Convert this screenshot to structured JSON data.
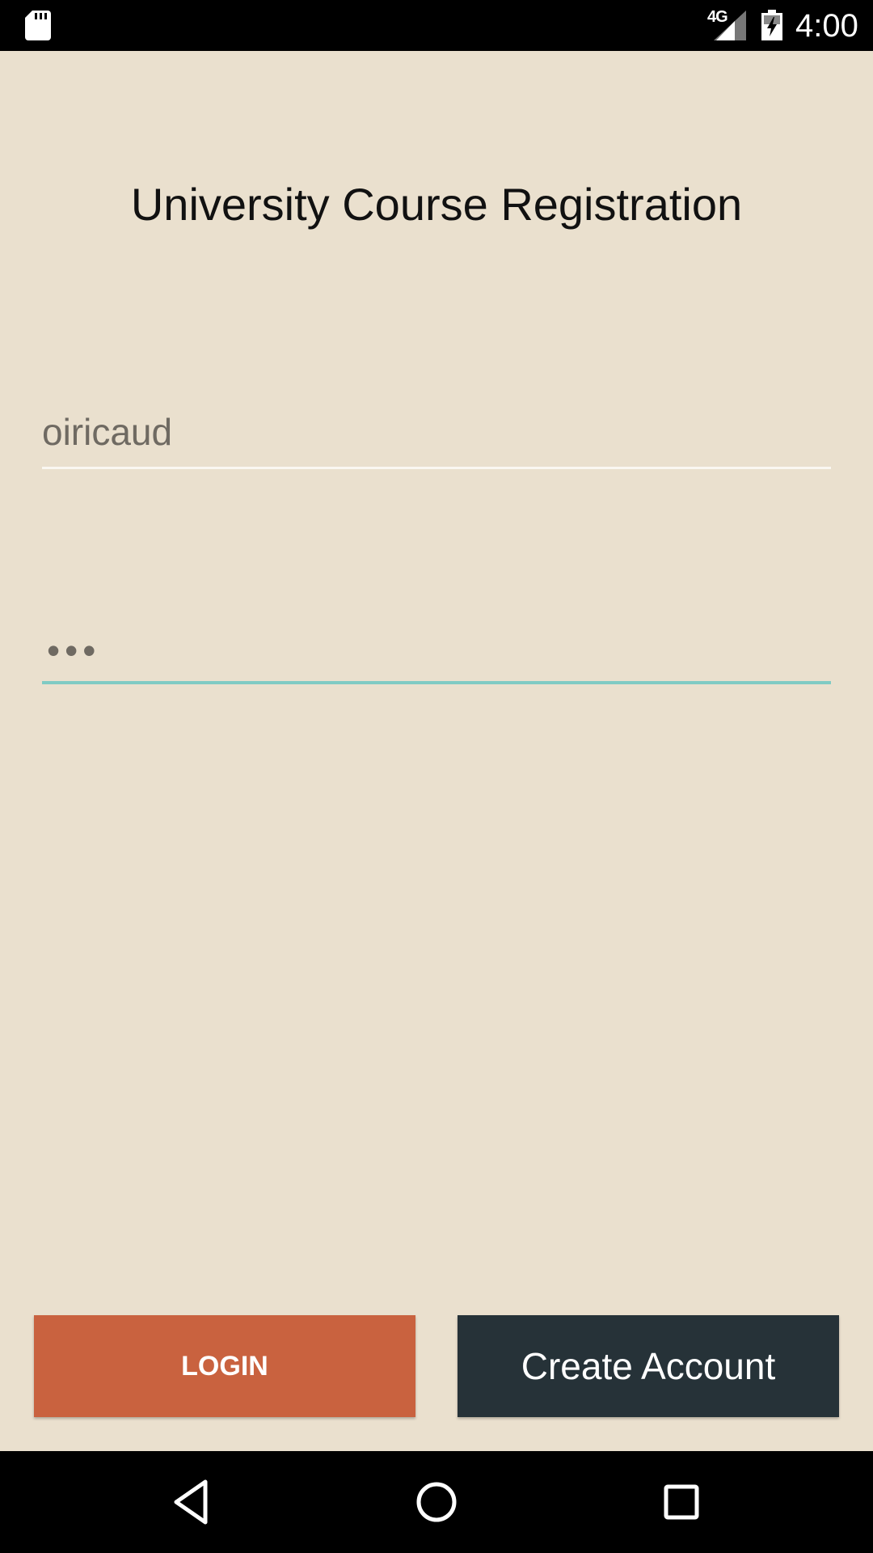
{
  "status_bar": {
    "network_type": "4G",
    "time": "4:00",
    "icons": [
      "sd-card-icon",
      "signal-icon",
      "battery-charging-icon"
    ]
  },
  "app": {
    "title": "University Course Registration",
    "username": {
      "value": "oiricaud"
    },
    "password": {
      "masked_value": "•••",
      "focused": true
    },
    "buttons": {
      "login": "LOGIN",
      "create_account": "Create Account"
    }
  },
  "nav_bar": {
    "icons": [
      "back-icon",
      "home-icon",
      "recents-icon"
    ]
  },
  "colors": {
    "background": "#EAE0CE",
    "login_button": "#C9623F",
    "create_account_button": "#263238",
    "focus_underline": "#80CBC4"
  }
}
